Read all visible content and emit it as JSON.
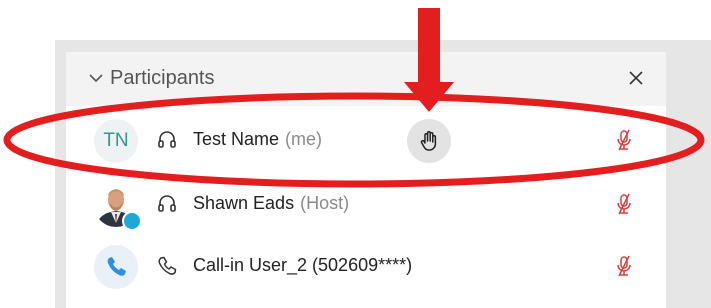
{
  "panel": {
    "title": "Participants",
    "collapse_icon": "chevron-down-icon",
    "close_icon": "close-icon"
  },
  "participants": [
    {
      "initials": "TN",
      "name": "Test Name",
      "role": "(me)",
      "connection_icon": "headset-icon",
      "hand_raised": true,
      "hand_icon": "raise-hand-icon",
      "mute_icon": "microphone-muted-icon"
    },
    {
      "initials": "",
      "name": "Shawn Eads",
      "role": "(Host)",
      "connection_icon": "headset-icon",
      "avatar": "photo",
      "presence_icon": "presence-status-icon",
      "mute_icon": "microphone-muted-icon"
    },
    {
      "initials": "",
      "name": "Call-in User_2 (502609****)",
      "role": "",
      "connection_icon": "phone-icon",
      "avatar_icon": "phone-avatar-icon",
      "mute_icon": "microphone-muted-icon"
    }
  ],
  "annotation": {
    "color": "#e31e1e",
    "arrow_icon": "down-arrow-annotation",
    "ellipse": "highlight-ellipse-annotation"
  },
  "colors": {
    "initials": "#2a9a8a",
    "mute": "#e03b3b",
    "header_bg": "#f3f3f3"
  }
}
